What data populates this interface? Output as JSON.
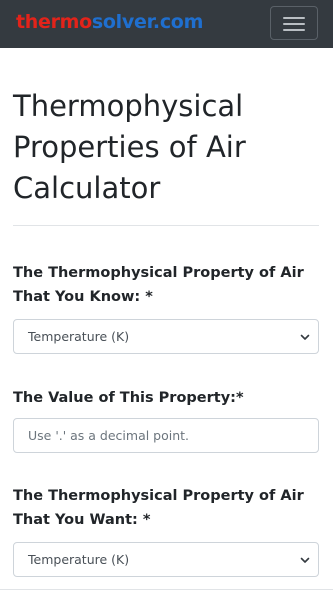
{
  "navbar": {
    "brand_part1": "thermo",
    "brand_part2": "solver.com",
    "brand_color_red": "#e2231a",
    "brand_color_blue": "#1f6fcf",
    "background": "#343a40",
    "menu_icon": "hamburger-menu-icon"
  },
  "main": {
    "title": "Thermophysical Properties of Air Calculator",
    "known_property_label": "The Thermophysical Property of Air That You Know: *",
    "known_property_selected": "Temperature (K)",
    "value_label": "The Value of This Property:*",
    "value_placeholder": "Use '.' as a decimal point.",
    "value_current": "",
    "wanted_property_label": "The Thermophysical Property of Air That You Want: *",
    "wanted_property_selected": "Temperature (K)",
    "select_icon": "chevron-down-icon"
  }
}
